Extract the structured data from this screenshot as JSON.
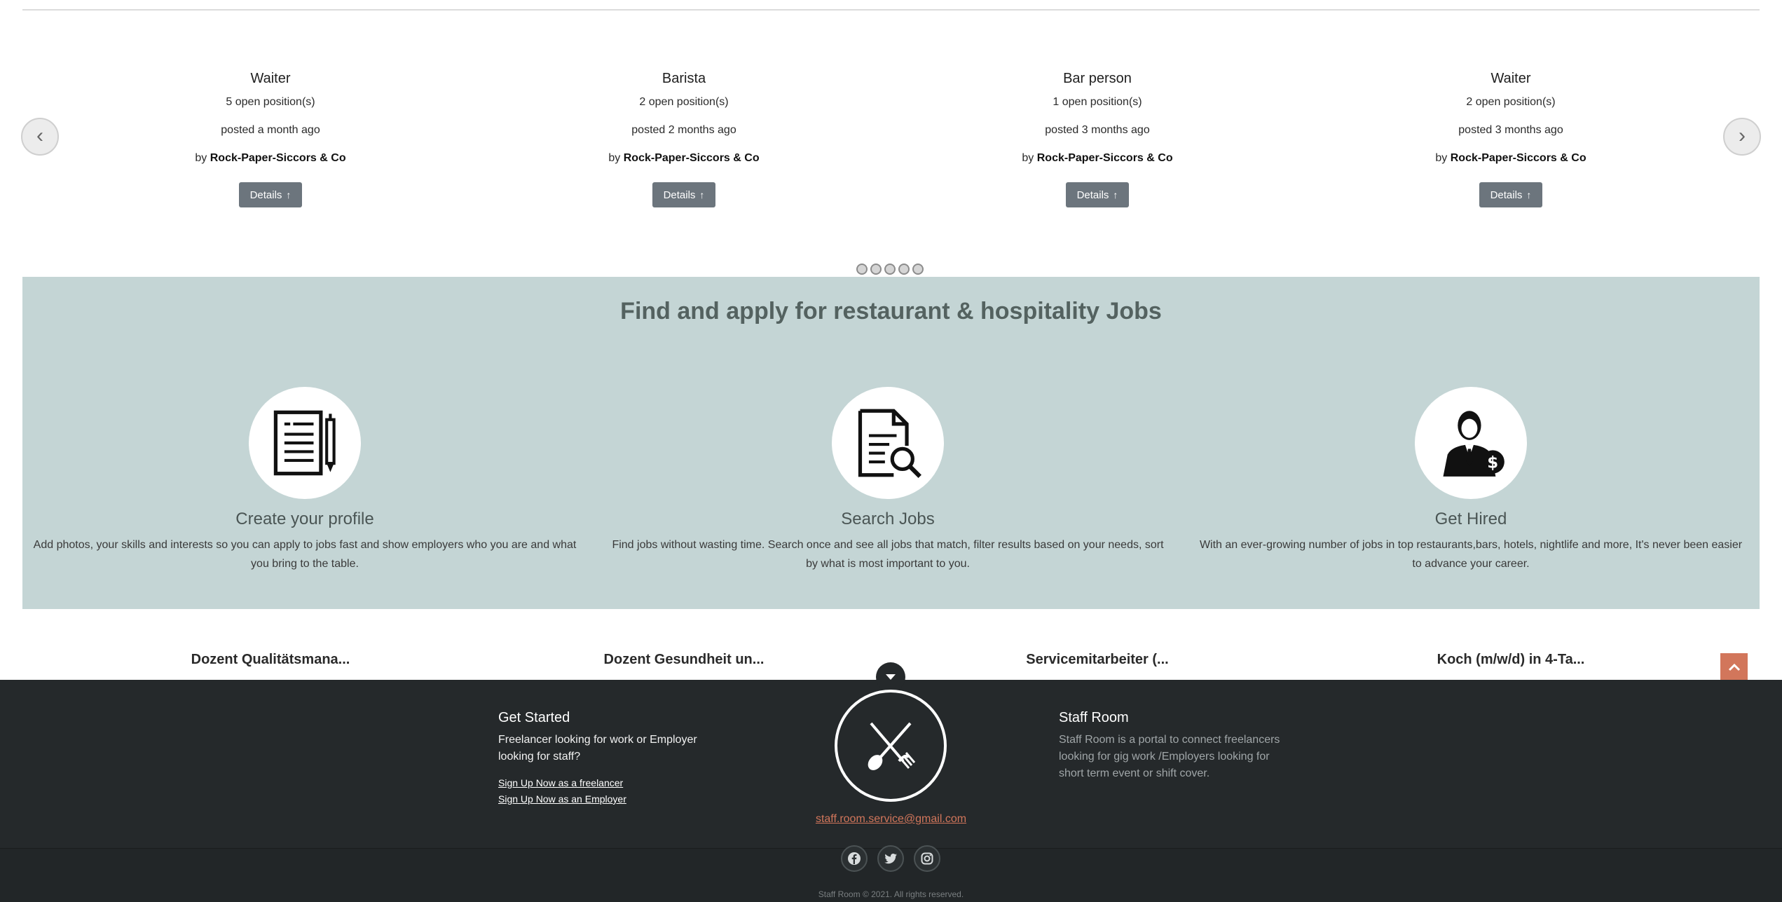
{
  "carousel": {
    "cards": [
      {
        "title": "Waiter",
        "positions": "5 open position(s)",
        "posted": "posted a month ago",
        "by_prefix": "by",
        "company": "Rock-Paper-Siccors & Co",
        "button": "Details"
      },
      {
        "title": "Barista",
        "positions": "2 open position(s)",
        "posted": "posted 2 months ago",
        "by_prefix": "by",
        "company": "Rock-Paper-Siccors & Co",
        "button": "Details"
      },
      {
        "title": "Bar person",
        "positions": "1 open position(s)",
        "posted": "posted 3 months ago",
        "by_prefix": "by",
        "company": "Rock-Paper-Siccors & Co",
        "button": "Details"
      },
      {
        "title": "Waiter",
        "positions": "2 open position(s)",
        "posted": "posted 3 months ago",
        "by_prefix": "by",
        "company": "Rock-Paper-Siccors & Co",
        "button": "Details"
      }
    ],
    "prev_glyph": "‹",
    "next_glyph": "›",
    "dot_count": 5
  },
  "band": {
    "heading": "Find and apply for restaurant & hospitality Jobs",
    "features": [
      {
        "icon": "resume-pen-icon",
        "title": "Create your profile",
        "text": "Add photos, your skills and interests so you can apply to jobs fast and show employers who you are and what you bring to the table."
      },
      {
        "icon": "document-search-icon",
        "title": "Search Jobs",
        "text": "Find jobs without wasting time. Search once and see all jobs that match, filter results based on your needs, sort by what is most important to you."
      },
      {
        "icon": "businessman-money-icon",
        "title": "Get Hired",
        "text": "With an ever-growing number of jobs in top restaurants,bars, hotels, nightlife and more, It's never been easier to advance your career."
      }
    ]
  },
  "ticker": {
    "items": [
      "Dozent Qualitätsmana...",
      "Dozent Gesundheit un...",
      "Servicemitarbeiter (...",
      "Koch (m/w/d) in 4-Ta..."
    ]
  },
  "footer": {
    "get_started": {
      "title": "Get Started",
      "text": "Freelancer looking for work or Employer looking for staff?",
      "link_freelancer": "Sign Up Now as a freelancer",
      "link_employer": "Sign Up Now as an Employer"
    },
    "staff_room": {
      "title": "Staff Room",
      "text": "Staff Room is a portal to connect freelancers looking for gig work /Employers looking for short term event or shift cover."
    },
    "logo_icon": "fork-spoon-icon",
    "email": "staff.room.service@gmail.com",
    "socials": [
      "facebook-icon",
      "twitter-icon",
      "instagram-icon"
    ],
    "copyright": "Staff Room © 2021. All rights reserved."
  },
  "colors": {
    "band_bg": "#c4d5d5",
    "footer_bg": "#25292b",
    "accent": "#d2765b",
    "button_bg": "#6c757d"
  }
}
